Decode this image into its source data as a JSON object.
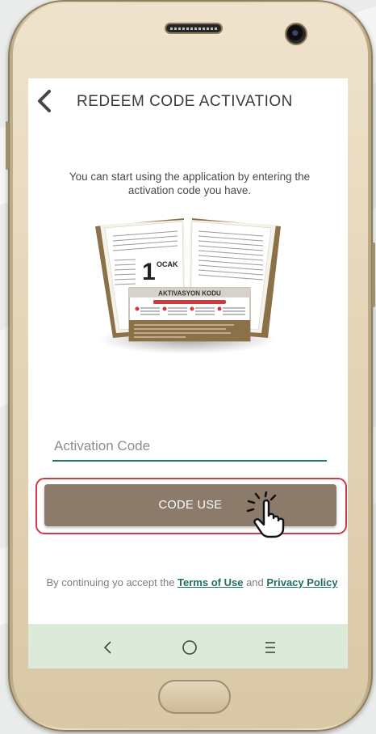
{
  "header": {
    "title": "REDEEM CODE ACTIVATION"
  },
  "intro_text": "You can start using the application by entering the activation code you have.",
  "illustration": {
    "card_title": "AKTIVASYON KODU",
    "calendar_month": "OCAK",
    "calendar_day": "1"
  },
  "activation_field": {
    "placeholder": "Activation Code",
    "value": ""
  },
  "primary_button": {
    "label": "CODE USE"
  },
  "legal": {
    "prefix": "By continuing yo accept the ",
    "terms_label": "Terms of Use",
    "middle": " and ",
    "privacy_label": "Privacy Policy"
  },
  "colors": {
    "accent": "#1f6f61",
    "button": "#8c7a6b",
    "highlight": "#cf3a43",
    "navbar": "#dcebd9"
  }
}
